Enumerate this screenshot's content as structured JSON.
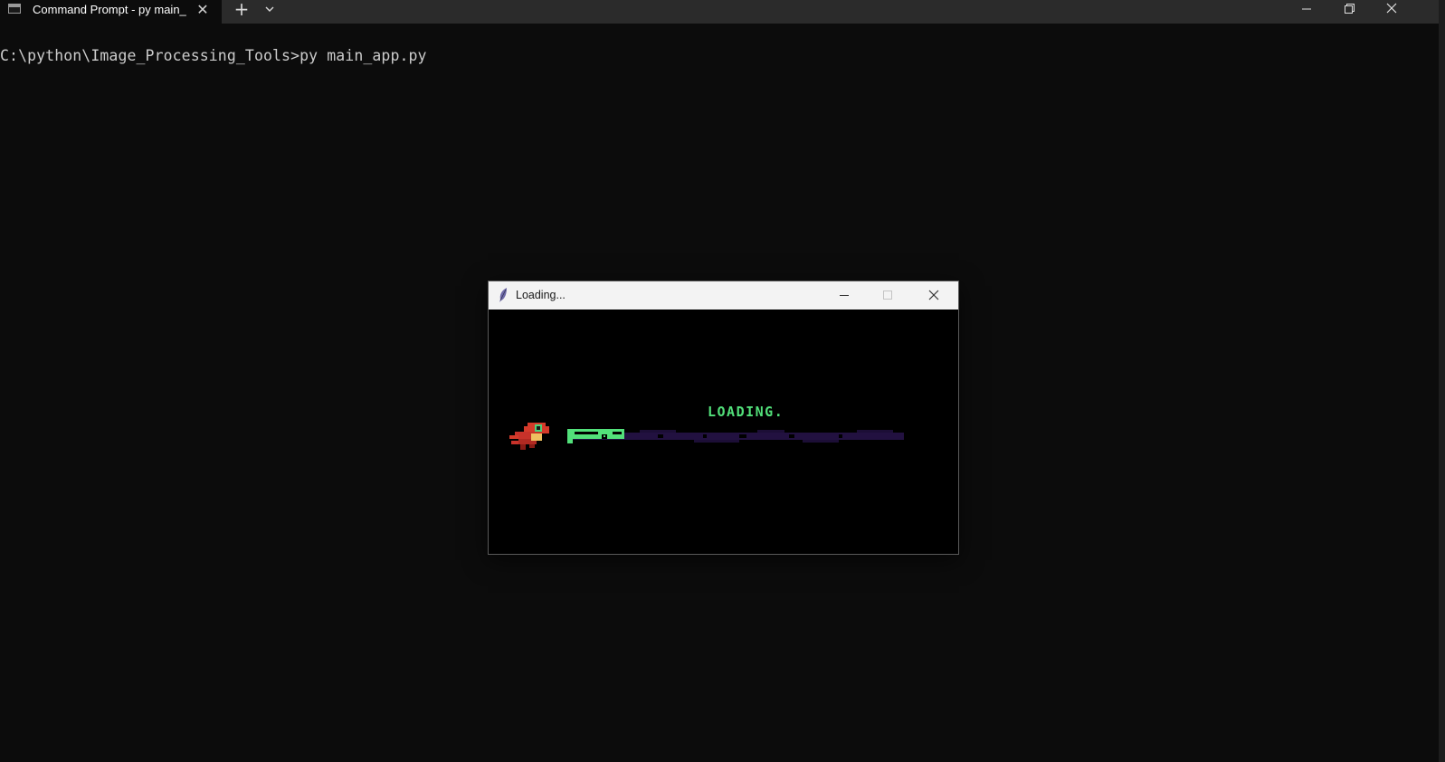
{
  "terminal": {
    "tab_title": "Command Prompt - py  main_",
    "command_line": "C:\\python\\Image_Processing_Tools>py main_app.py"
  },
  "dialog": {
    "title": "Loading...",
    "loading_text": "LOADING.",
    "progress": 0.17,
    "colors": {
      "progress_fill": "#52e07a",
      "progress_track": "#221140",
      "dino": "#d43a2a"
    }
  }
}
